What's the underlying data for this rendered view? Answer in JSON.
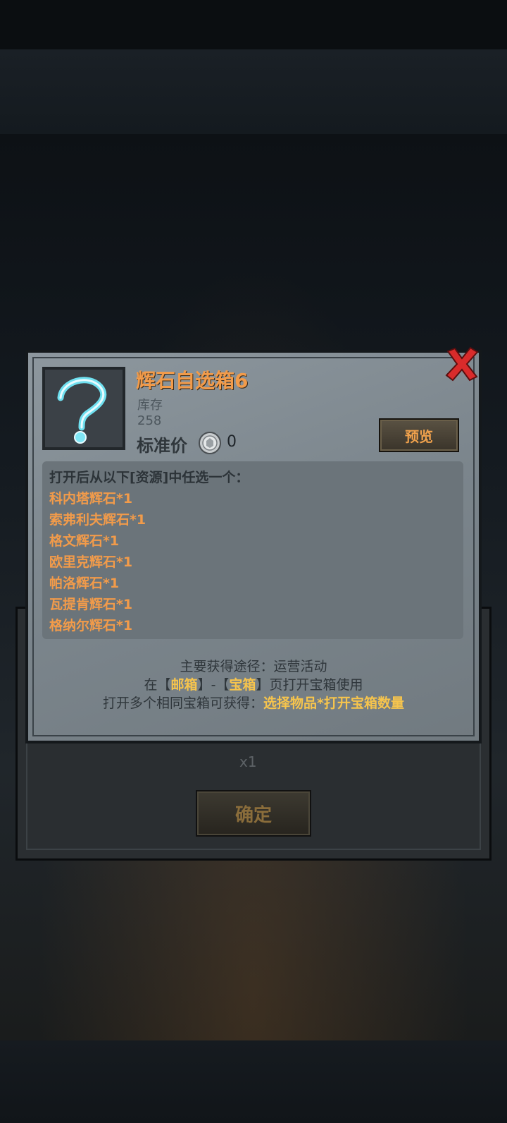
{
  "background": {
    "quantity_label": "x1",
    "confirm_label": "确定"
  },
  "item": {
    "name": "辉石自选箱6",
    "stock_label": "库存",
    "stock_value": "258",
    "price_label": "标准价",
    "price_value": "0",
    "preview_label": "预览"
  },
  "contents": {
    "header": "打开后从以下[资源]中任选一个：",
    "items": [
      "科内塔辉石*1",
      "索弗利夫辉石*1",
      "格文辉石*1",
      "欧里克辉石*1",
      "帕洛辉石*1",
      "瓦提肯辉石*1",
      "格纳尔辉石*1"
    ]
  },
  "notes": {
    "source": "主要获得途径：运营活动",
    "usage_prefix": "在【",
    "usage_mail": "邮箱",
    "usage_mid": "】-【",
    "usage_box": "宝箱",
    "usage_suffix": "】页打开宝箱使用",
    "multi_prefix": "打开多个相同宝箱可获得：",
    "multi_hl": "选择物品*打开宝箱数量"
  },
  "icons": {
    "close": "close-x-icon",
    "item": "question-mark-icon",
    "currency": "silver-coin-icon"
  },
  "colors": {
    "accent_orange": "#f29b4a",
    "highlight_yellow": "#f6c44d",
    "close_red": "#d92b2b"
  }
}
